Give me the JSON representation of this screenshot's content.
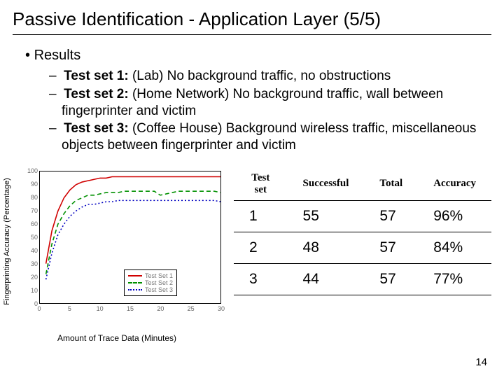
{
  "title": "Passive Identification - Application Layer (5/5)",
  "results_heading": "Results",
  "tests": [
    {
      "label": "Test set 1:",
      "desc": "(Lab) No background traffic, no obstructions"
    },
    {
      "label": "Test set 2:",
      "desc": "(Home Network) No background traffic, wall between fingerprinter and victim"
    },
    {
      "label": "Test set 3:",
      "desc": "(Coffee House) Background wireless traffic, miscellaneous objects between fingerprinter and victim"
    }
  ],
  "chart_data": {
    "type": "line",
    "xlabel": "Amount of Trace Data (Minutes)",
    "ylabel": "Fingerprinting Accuracy (Percentage)",
    "xlim": [
      0,
      30
    ],
    "ylim": [
      0,
      100
    ],
    "x_ticks": [
      0,
      5,
      10,
      15,
      20,
      25,
      30
    ],
    "y_ticks": [
      0,
      10,
      20,
      30,
      40,
      50,
      60,
      70,
      80,
      90,
      100
    ],
    "legend": [
      "Test Set 1",
      "Test Set 2",
      "Test Set 3"
    ],
    "series": [
      {
        "name": "Test Set 1",
        "color": "#d00000",
        "dash": "solid",
        "x": [
          1,
          2,
          3,
          4,
          5,
          6,
          7,
          8,
          9,
          10,
          11,
          12,
          13,
          14,
          15,
          16,
          17,
          18,
          19,
          20,
          21,
          22,
          23,
          24,
          25,
          26,
          27,
          28,
          29,
          30
        ],
        "y": [
          30,
          55,
          70,
          80,
          86,
          90,
          92,
          93,
          94,
          95,
          95,
          96,
          96,
          96,
          96,
          96,
          96,
          96,
          96,
          96,
          96,
          96,
          96,
          96,
          96,
          96,
          96,
          96,
          96,
          96
        ]
      },
      {
        "name": "Test Set 2",
        "color": "#009000",
        "dash": "dashed",
        "x": [
          1,
          2,
          3,
          4,
          5,
          6,
          7,
          8,
          9,
          10,
          11,
          12,
          13,
          14,
          15,
          16,
          17,
          18,
          19,
          20,
          21,
          22,
          23,
          24,
          25,
          26,
          27,
          28,
          29,
          30
        ],
        "y": [
          22,
          45,
          60,
          68,
          74,
          78,
          80,
          82,
          82,
          83,
          84,
          84,
          84,
          85,
          85,
          85,
          85,
          85,
          85,
          82,
          83,
          84,
          85,
          85,
          85,
          85,
          85,
          85,
          85,
          84
        ]
      },
      {
        "name": "Test Set 3",
        "color": "#0000c0",
        "dash": "dotted",
        "x": [
          1,
          2,
          3,
          4,
          5,
          6,
          7,
          8,
          9,
          10,
          11,
          12,
          13,
          14,
          15,
          16,
          17,
          18,
          19,
          20,
          21,
          22,
          23,
          24,
          25,
          26,
          27,
          28,
          29,
          30
        ],
        "y": [
          18,
          38,
          52,
          60,
          66,
          70,
          73,
          75,
          75,
          76,
          77,
          77,
          78,
          78,
          78,
          78,
          78,
          78,
          78,
          78,
          78,
          78,
          78,
          78,
          78,
          78,
          78,
          78,
          78,
          77
        ]
      }
    ]
  },
  "table": {
    "headers": [
      "Test set",
      "Successful",
      "Total",
      "Accuracy"
    ],
    "rows": [
      [
        "1",
        "55",
        "57",
        "96%"
      ],
      [
        "2",
        "48",
        "57",
        "84%"
      ],
      [
        "3",
        "44",
        "57",
        "77%"
      ]
    ]
  },
  "page_number": "14"
}
